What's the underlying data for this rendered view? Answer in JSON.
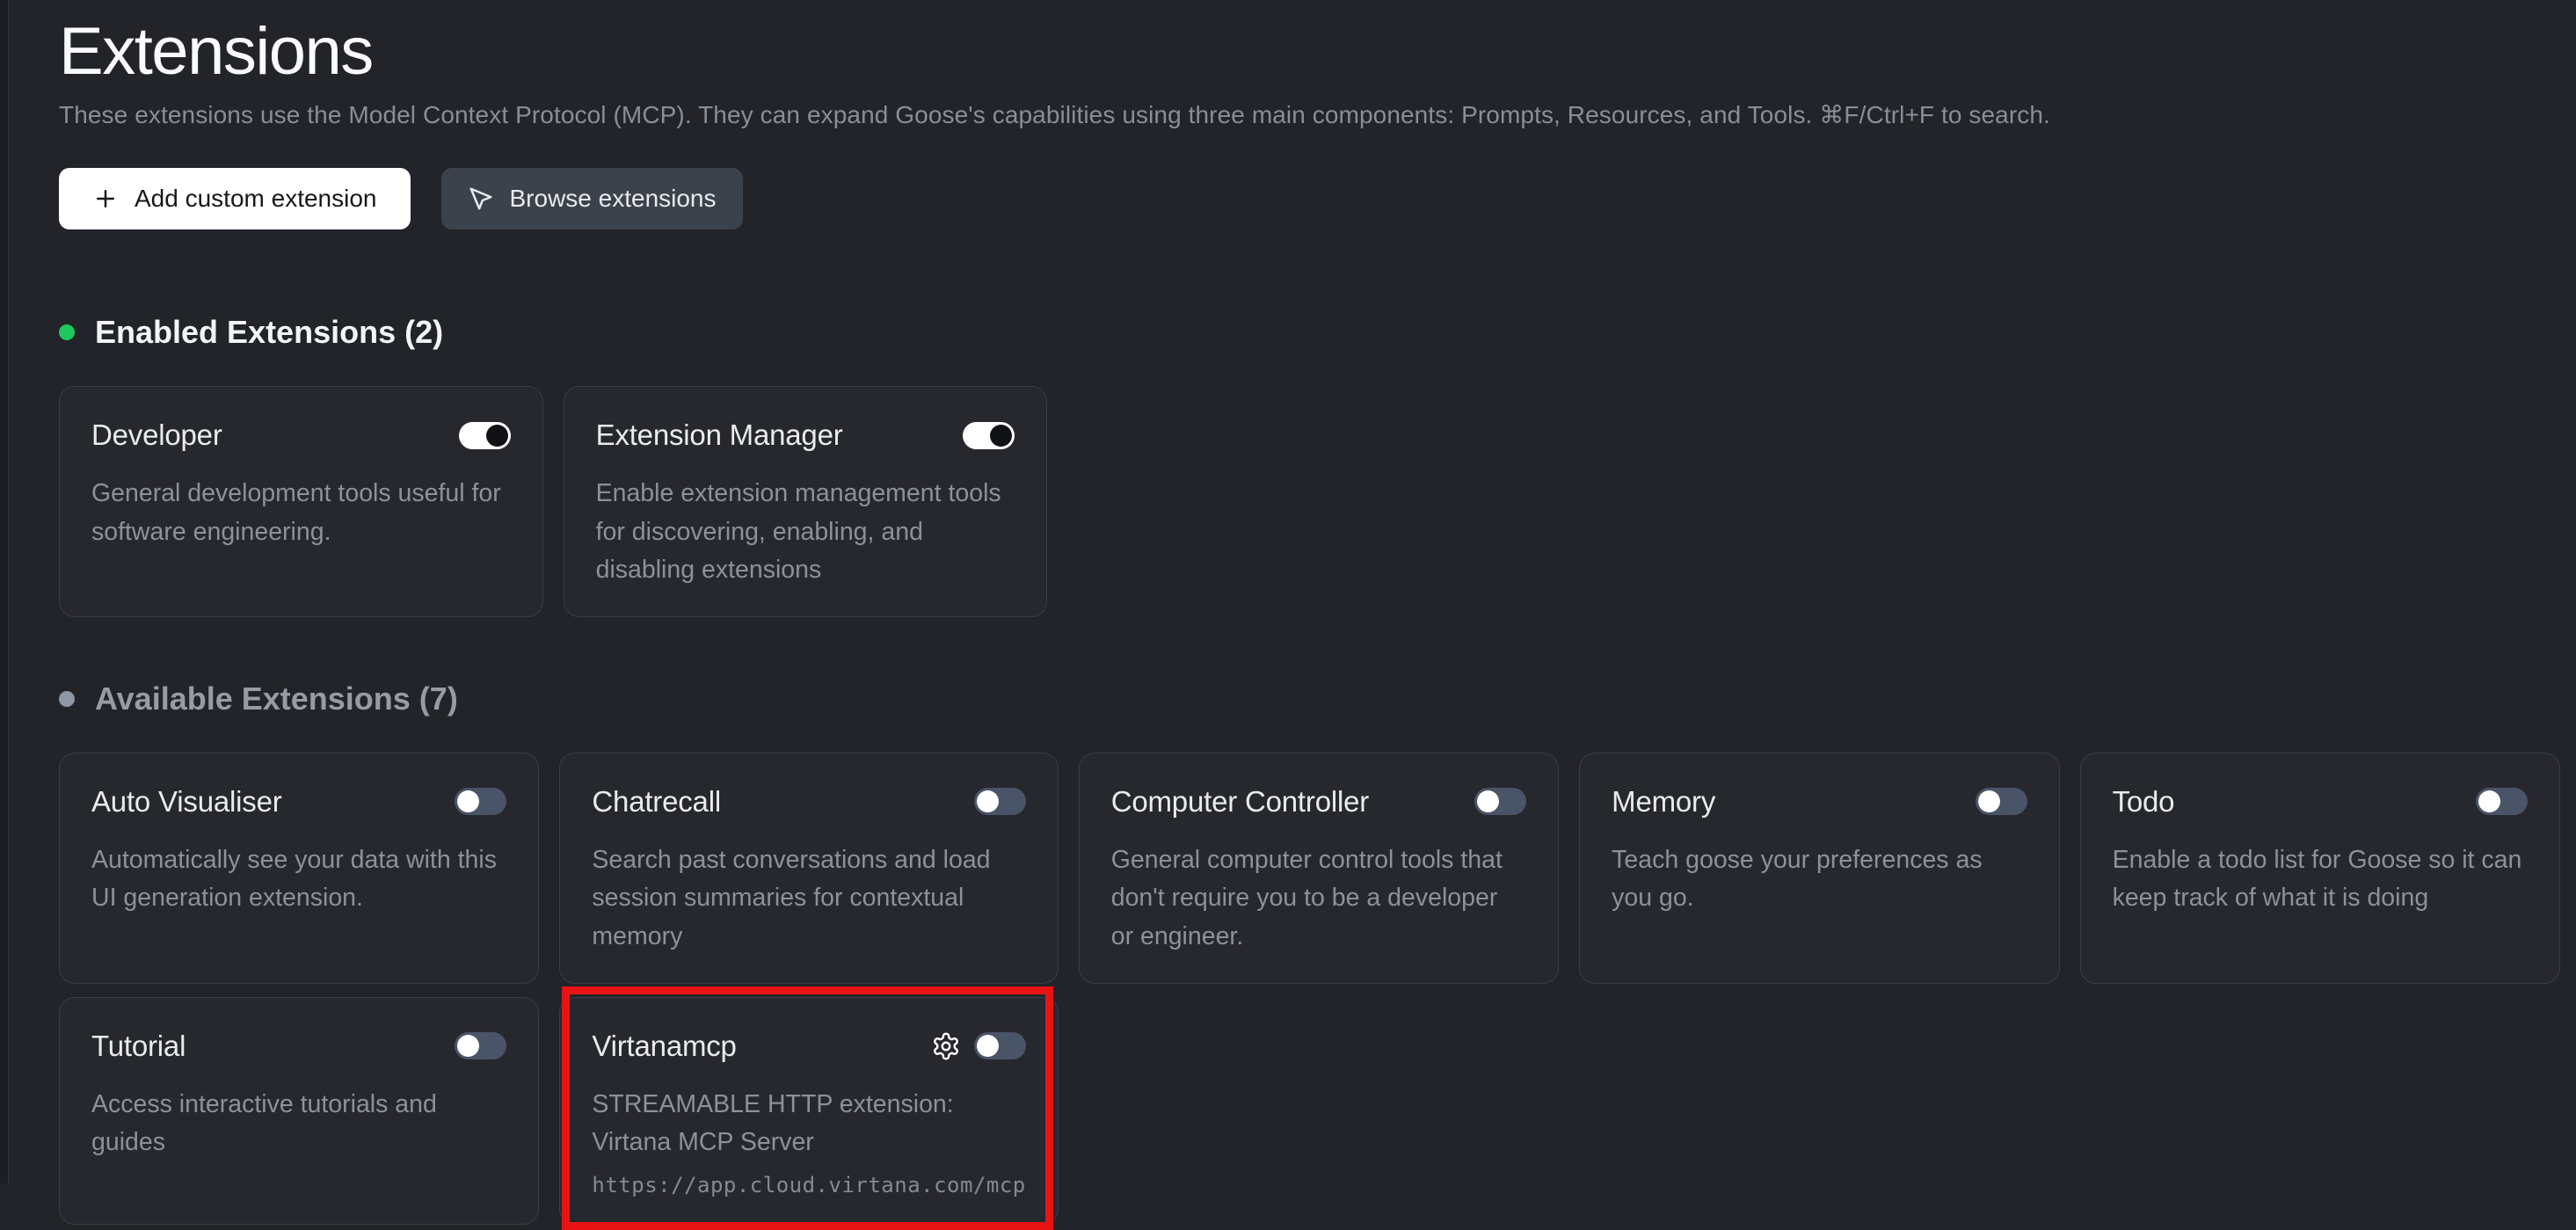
{
  "page": {
    "title": "Extensions",
    "subtitle": "These extensions use the Model Context Protocol (MCP). They can expand Goose's capabilities using three main components: Prompts, Resources, and Tools. ⌘F/Ctrl+F to search."
  },
  "toolbar": {
    "add_button_label": "Add custom extension",
    "browse_button_label": "Browse extensions"
  },
  "sections": {
    "enabled": {
      "label": "Enabled Extensions (2)",
      "dot_color": "#1ec85a"
    },
    "available": {
      "label": "Available Extensions (7)",
      "dot_color": "#8d97a6"
    }
  },
  "enabled_cards": [
    {
      "title": "Developer",
      "description": "General development tools useful for software engineering.",
      "toggle": "on"
    },
    {
      "title": "Extension Manager",
      "description": "Enable extension management tools for discovering, enabling, and disabling extensions",
      "toggle": "on"
    }
  ],
  "available_cards": [
    {
      "title": "Auto Visualiser",
      "description": "Automatically see your data with this UI generation extension.",
      "toggle": "off"
    },
    {
      "title": "Chatrecall",
      "description": "Search past conversations and load session summaries for contextual memory",
      "toggle": "off"
    },
    {
      "title": "Computer Controller",
      "description": "General computer control tools that don't require you to be a developer or engineer.",
      "toggle": "off"
    },
    {
      "title": "Memory",
      "description": "Teach goose your preferences as you go.",
      "toggle": "off"
    },
    {
      "title": "Todo",
      "description": "Enable a todo list for Goose so it can keep track of what it is doing",
      "toggle": "off"
    },
    {
      "title": "Tutorial",
      "description": "Access interactive tutorials and guides",
      "toggle": "off"
    },
    {
      "title": "Virtanamcp",
      "description": "STREAMABLE HTTP extension: Virtana MCP Server",
      "url": "https://app.cloud.virtana.com/mcp",
      "toggle": "off",
      "highlighted": true
    }
  ],
  "colors": {
    "background": "#222429",
    "card_background": "#27282e",
    "card_border": "#3b3d44",
    "toggle_on_track": "#ffffff",
    "toggle_on_knob": "#101216",
    "toggle_off_track": "#4a5468",
    "toggle_off_knob": "#ffffff",
    "enabled_dot": "#1ec85a",
    "available_dot": "#8d97a6",
    "annotation_highlight": "#e81414"
  }
}
